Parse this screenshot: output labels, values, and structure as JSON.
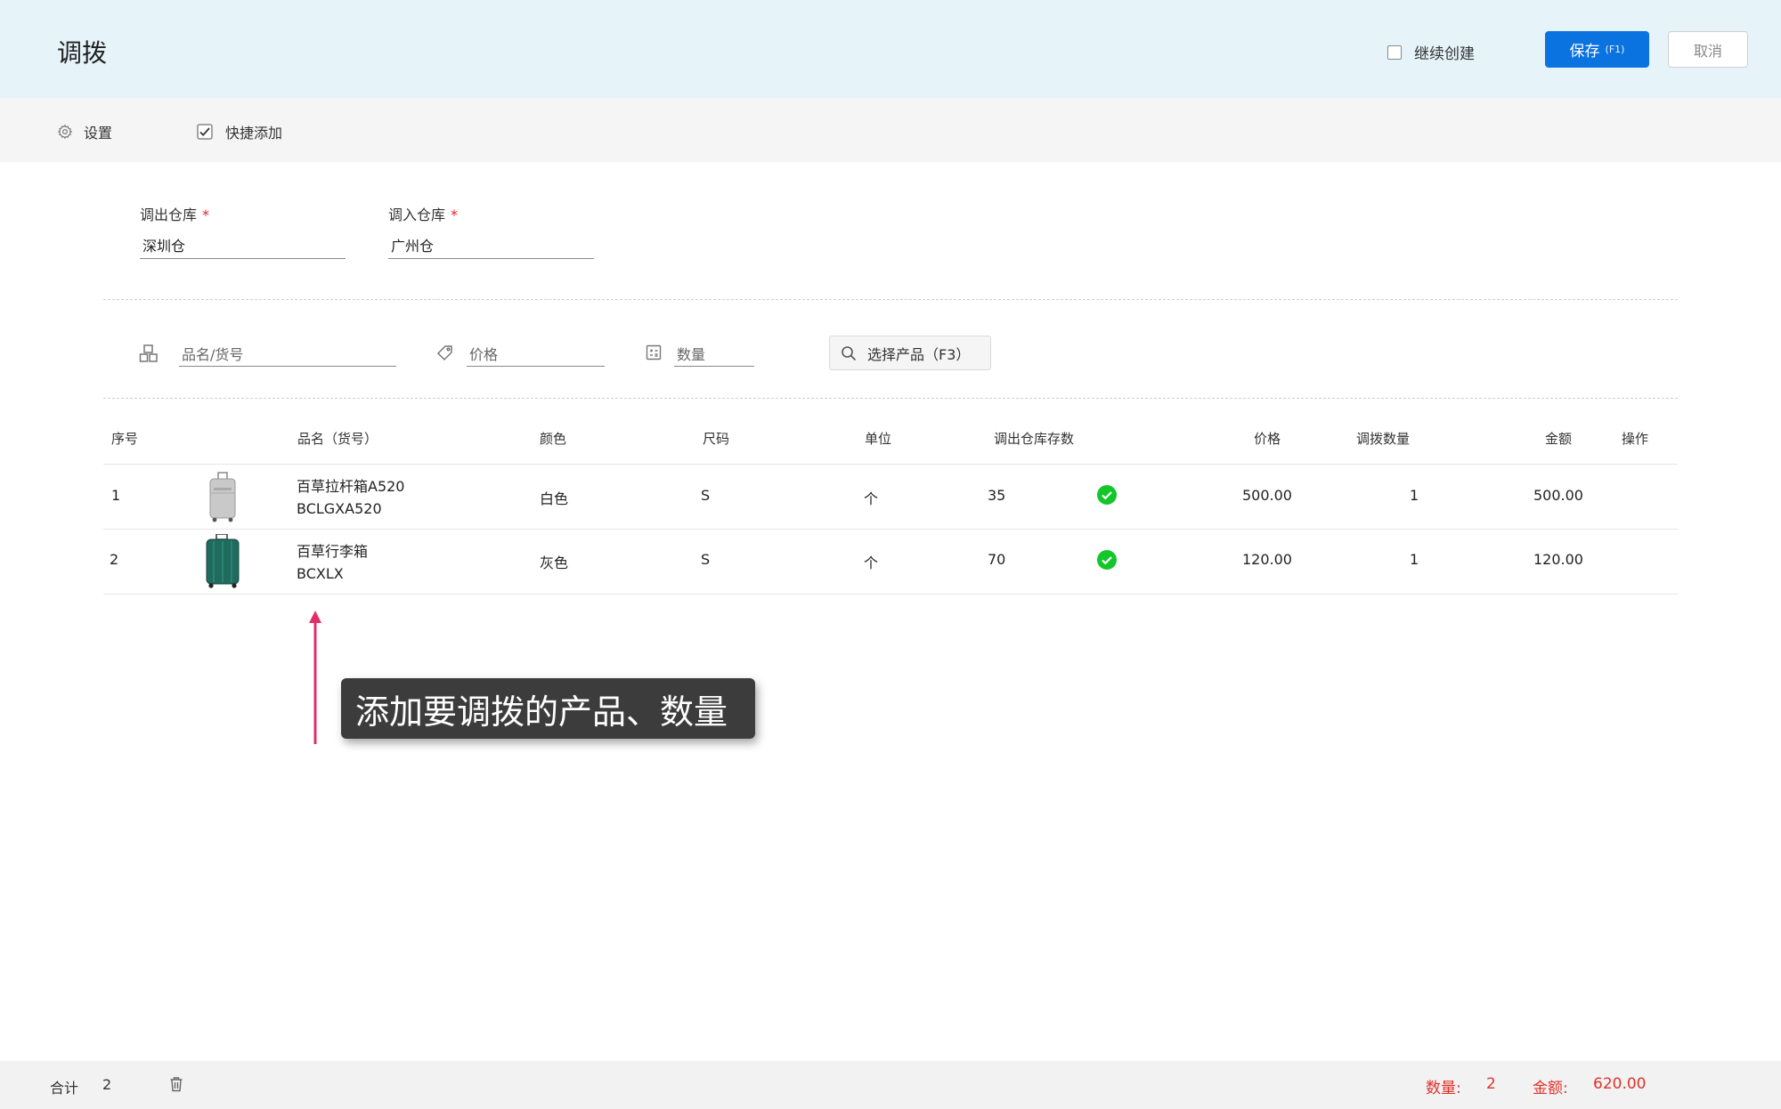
{
  "header": {
    "title": "调拨",
    "continue_create_label": "继续创建",
    "save_label": "保存",
    "save_hint": "(F1)",
    "cancel_label": "取消"
  },
  "toolbar": {
    "settings_label": "设置",
    "quick_add_label": "快捷添加",
    "quick_add_checked": true
  },
  "form": {
    "out_warehouse_label": "调出仓库",
    "out_warehouse_value": "深圳仓",
    "in_warehouse_label": "调入仓库",
    "in_warehouse_value": "广州仓",
    "required_mark": "*"
  },
  "quick_add": {
    "name_placeholder": "品名/货号",
    "price_placeholder": "价格",
    "qty_placeholder": "数量",
    "select_product_label": "选择产品（F3）"
  },
  "table": {
    "headers": {
      "index": "序号",
      "name": "品名（货号）",
      "color": "颜色",
      "size": "尺码",
      "unit": "单位",
      "stock": "调出仓库存数",
      "price": "价格",
      "qty": "调拨数量",
      "amount": "金额",
      "action": "操作"
    },
    "rows": [
      {
        "index": "1",
        "name": "百草拉杆箱A520",
        "code": "BCLGXA520",
        "color": "白色",
        "size": "S",
        "unit": "个",
        "stock": "35",
        "price": "500.00",
        "qty": "1",
        "amount": "500.00",
        "image": "silver-suitcase"
      },
      {
        "index": "2",
        "name": "百草行李箱",
        "code": "BCXLX",
        "color": "灰色",
        "size": "S",
        "unit": "个",
        "stock": "70",
        "price": "120.00",
        "qty": "1",
        "amount": "120.00",
        "image": "green-suitcase"
      }
    ]
  },
  "annotation": {
    "text": "添加要调拨的产品、数量",
    "arrow_color": "#e0306a"
  },
  "footer": {
    "total_label": "合计",
    "total_count": "2",
    "qty_label": "数量:",
    "qty_value": "2",
    "amount_label": "金额:",
    "amount_value": "620.00"
  },
  "colors": {
    "primary": "#0b73e0",
    "header_bg": "#e6f4fa",
    "status_ok": "#13c62a",
    "total_red": "#e0322c"
  }
}
